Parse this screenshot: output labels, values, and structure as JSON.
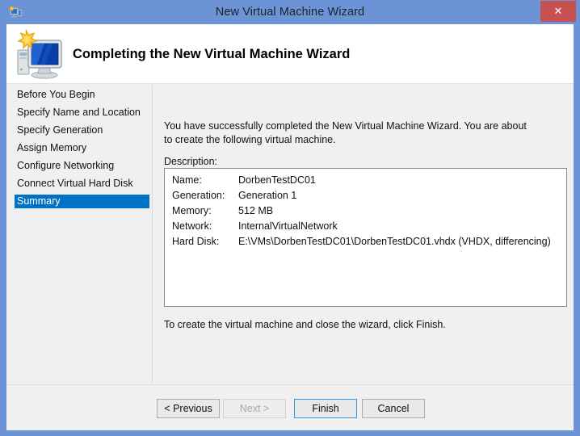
{
  "window": {
    "title": "New Virtual Machine Wizard",
    "title_icon": "virtual-machine-icon",
    "close_label": "✕",
    "accent_color": "#6b93d6",
    "close_color": "#c75050",
    "selection_color": "#0072c6",
    "focus_border_color": "#3399dd"
  },
  "banner": {
    "icon": "computer-monitor-star-icon",
    "title": "Completing the New Virtual Machine Wizard"
  },
  "sidebar": {
    "items": [
      {
        "label": "Before You Begin",
        "selected": false
      },
      {
        "label": "Specify Name and Location",
        "selected": false
      },
      {
        "label": "Specify Generation",
        "selected": false
      },
      {
        "label": "Assign Memory",
        "selected": false
      },
      {
        "label": "Configure Networking",
        "selected": false
      },
      {
        "label": "Connect Virtual Hard Disk",
        "selected": false
      },
      {
        "label": "Summary",
        "selected": true
      }
    ]
  },
  "main": {
    "intro_text": "You have successfully completed the New Virtual Machine Wizard. You are about to create the following virtual machine.",
    "description_label": "Description:",
    "description_rows": [
      {
        "key": "Name:",
        "value": "DorbenTestDC01"
      },
      {
        "key": "Generation:",
        "value": "Generation 1"
      },
      {
        "key": "Memory:",
        "value": "512 MB"
      },
      {
        "key": "Network:",
        "value": "InternalVirtualNetwork"
      },
      {
        "key": "Hard Disk:",
        "value": "E:\\VMs\\DorbenTestDC01\\DorbenTestDC01.vhdx (VHDX, differencing)"
      }
    ],
    "outro_text": "To create the virtual machine and close the wizard, click Finish."
  },
  "footer": {
    "previous_label": "< Previous",
    "next_label": "Next >",
    "finish_label": "Finish",
    "cancel_label": "Cancel"
  }
}
